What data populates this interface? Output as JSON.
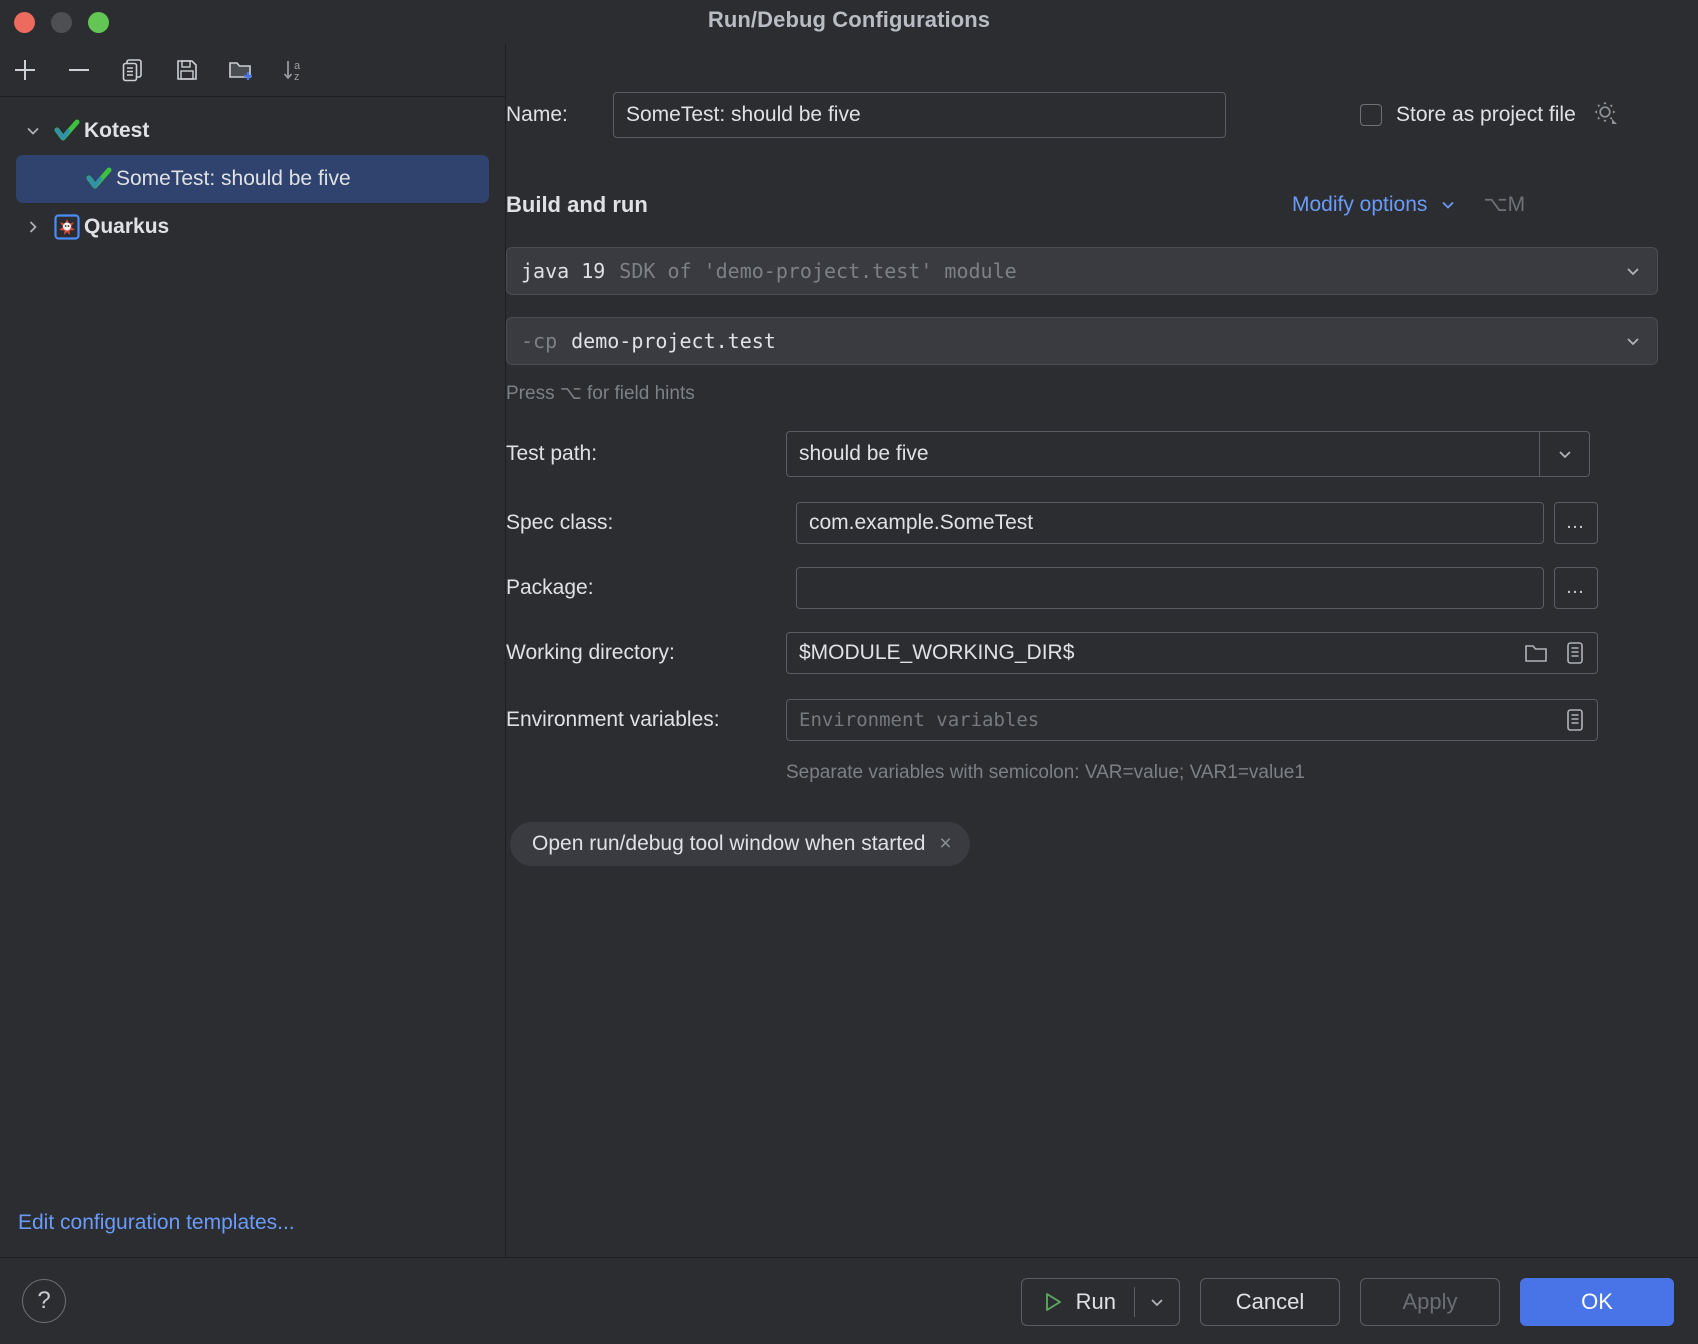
{
  "window": {
    "title": "Run/Debug Configurations",
    "traffic_lights": [
      "close",
      "minimize",
      "zoom"
    ]
  },
  "left_panel": {
    "toolbar": [
      {
        "name": "add-configuration-button",
        "icon": "plus-icon",
        "label": "+"
      },
      {
        "name": "remove-configuration-button",
        "icon": "minus-icon",
        "label": "−"
      },
      {
        "name": "copy-configuration-button",
        "icon": "copy-icon",
        "label": "Copy"
      },
      {
        "name": "save-configuration-button",
        "icon": "save-icon",
        "label": "Save"
      },
      {
        "name": "new-folder-button",
        "icon": "folder-add-icon",
        "label": "New Folder"
      },
      {
        "name": "sort-configurations-button",
        "icon": "sort-alphabetically-icon",
        "label": "Sort"
      }
    ],
    "tree": [
      {
        "label": "Kotest",
        "type": "group",
        "expanded": true,
        "twisty": "chevron-down-icon",
        "icon": "kotest-icon",
        "children": [
          {
            "label": "SomeTest: should be five",
            "type": "leaf",
            "icon": "kotest-icon",
            "selected": true
          }
        ]
      },
      {
        "label": "Quarkus",
        "type": "group",
        "expanded": false,
        "twisty": "chevron-right-icon",
        "icon": "quarkus-icon",
        "children": []
      }
    ],
    "edit_templates_link": "Edit configuration templates..."
  },
  "form": {
    "name_label": "Name:",
    "name_value": "SomeTest: should be five",
    "store_as_project_file_label": "Store as project file",
    "store_as_project_file_checked": false,
    "store_gear_icon": "gear-icon",
    "section_title": "Build and run",
    "modify_options_label": "Modify options",
    "modify_options_shortcut": "⌥M",
    "jre_prefix": "java 19",
    "jre_suffix": "SDK of 'demo-project.test' module",
    "classpath_prefix": "-cp",
    "classpath_value": "demo-project.test",
    "field_hints": "Press ⌥ for field hints",
    "fields": [
      {
        "name": "test-path",
        "label": "Test path:",
        "value": "should be five",
        "placeholder": "",
        "control": "combobox"
      },
      {
        "name": "spec-class",
        "label": "Spec class:",
        "value": "com.example.SomeTest",
        "placeholder": "",
        "control": "text-with-browse",
        "browse_label": "…"
      },
      {
        "name": "package",
        "label": "Package:",
        "value": "",
        "placeholder": "",
        "control": "text-with-browse",
        "browse_label": "…"
      },
      {
        "name": "working-directory",
        "label": "Working directory:",
        "value": "$MODULE_WORKING_DIR$",
        "placeholder": "",
        "control": "text-with-folder-and-macro"
      },
      {
        "name": "environment-variables",
        "label": "Environment variables:",
        "value": "",
        "placeholder": "Environment variables",
        "control": "text-with-macro"
      }
    ],
    "env_hint": "Separate variables with semicolon: VAR=value; VAR1=value1",
    "option_chip": {
      "label": "Open run/debug tool window when started",
      "close": "×"
    }
  },
  "footer": {
    "help_label": "?",
    "run_label": "Run",
    "cancel_label": "Cancel",
    "apply_label": "Apply",
    "ok_label": "OK",
    "apply_enabled": false
  },
  "colors": {
    "background": "#2b2d30",
    "field_background": "#393b40",
    "selection": "#2f436e",
    "accent_link": "#6b9bfa",
    "primary_button": "#4874e8",
    "border": "#5a5d63",
    "muted_text": "#7d8085"
  }
}
